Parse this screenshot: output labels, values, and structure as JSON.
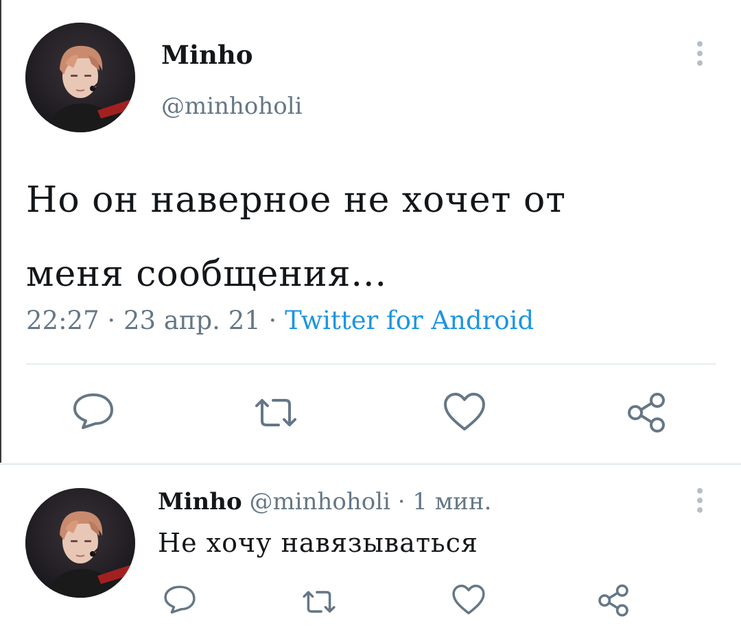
{
  "main_tweet": {
    "display_name": "Minho",
    "handle": "@minhoholi",
    "text_line1": "Но он наверное не хочет от",
    "text_line2": "меня сообщения...",
    "time": "22:27",
    "date": "23 апр. 21",
    "source": "Twitter for Android",
    "separator": " · "
  },
  "reply_tweet": {
    "display_name": "Minho",
    "handle": "@minhoholi",
    "time_ago": "1 мин.",
    "separator": " · ",
    "text": "Не хочу навязываться"
  },
  "icons": {
    "more": "more-vertical-icon",
    "reply": "reply-bubble-icon",
    "retweet": "retweet-icon",
    "like": "heart-icon",
    "share": "share-icon"
  },
  "colors": {
    "text": "#14171a",
    "secondary": "#657786",
    "link": "#1b95e0",
    "icon": "#657786",
    "divider": "#e6ecf0"
  }
}
